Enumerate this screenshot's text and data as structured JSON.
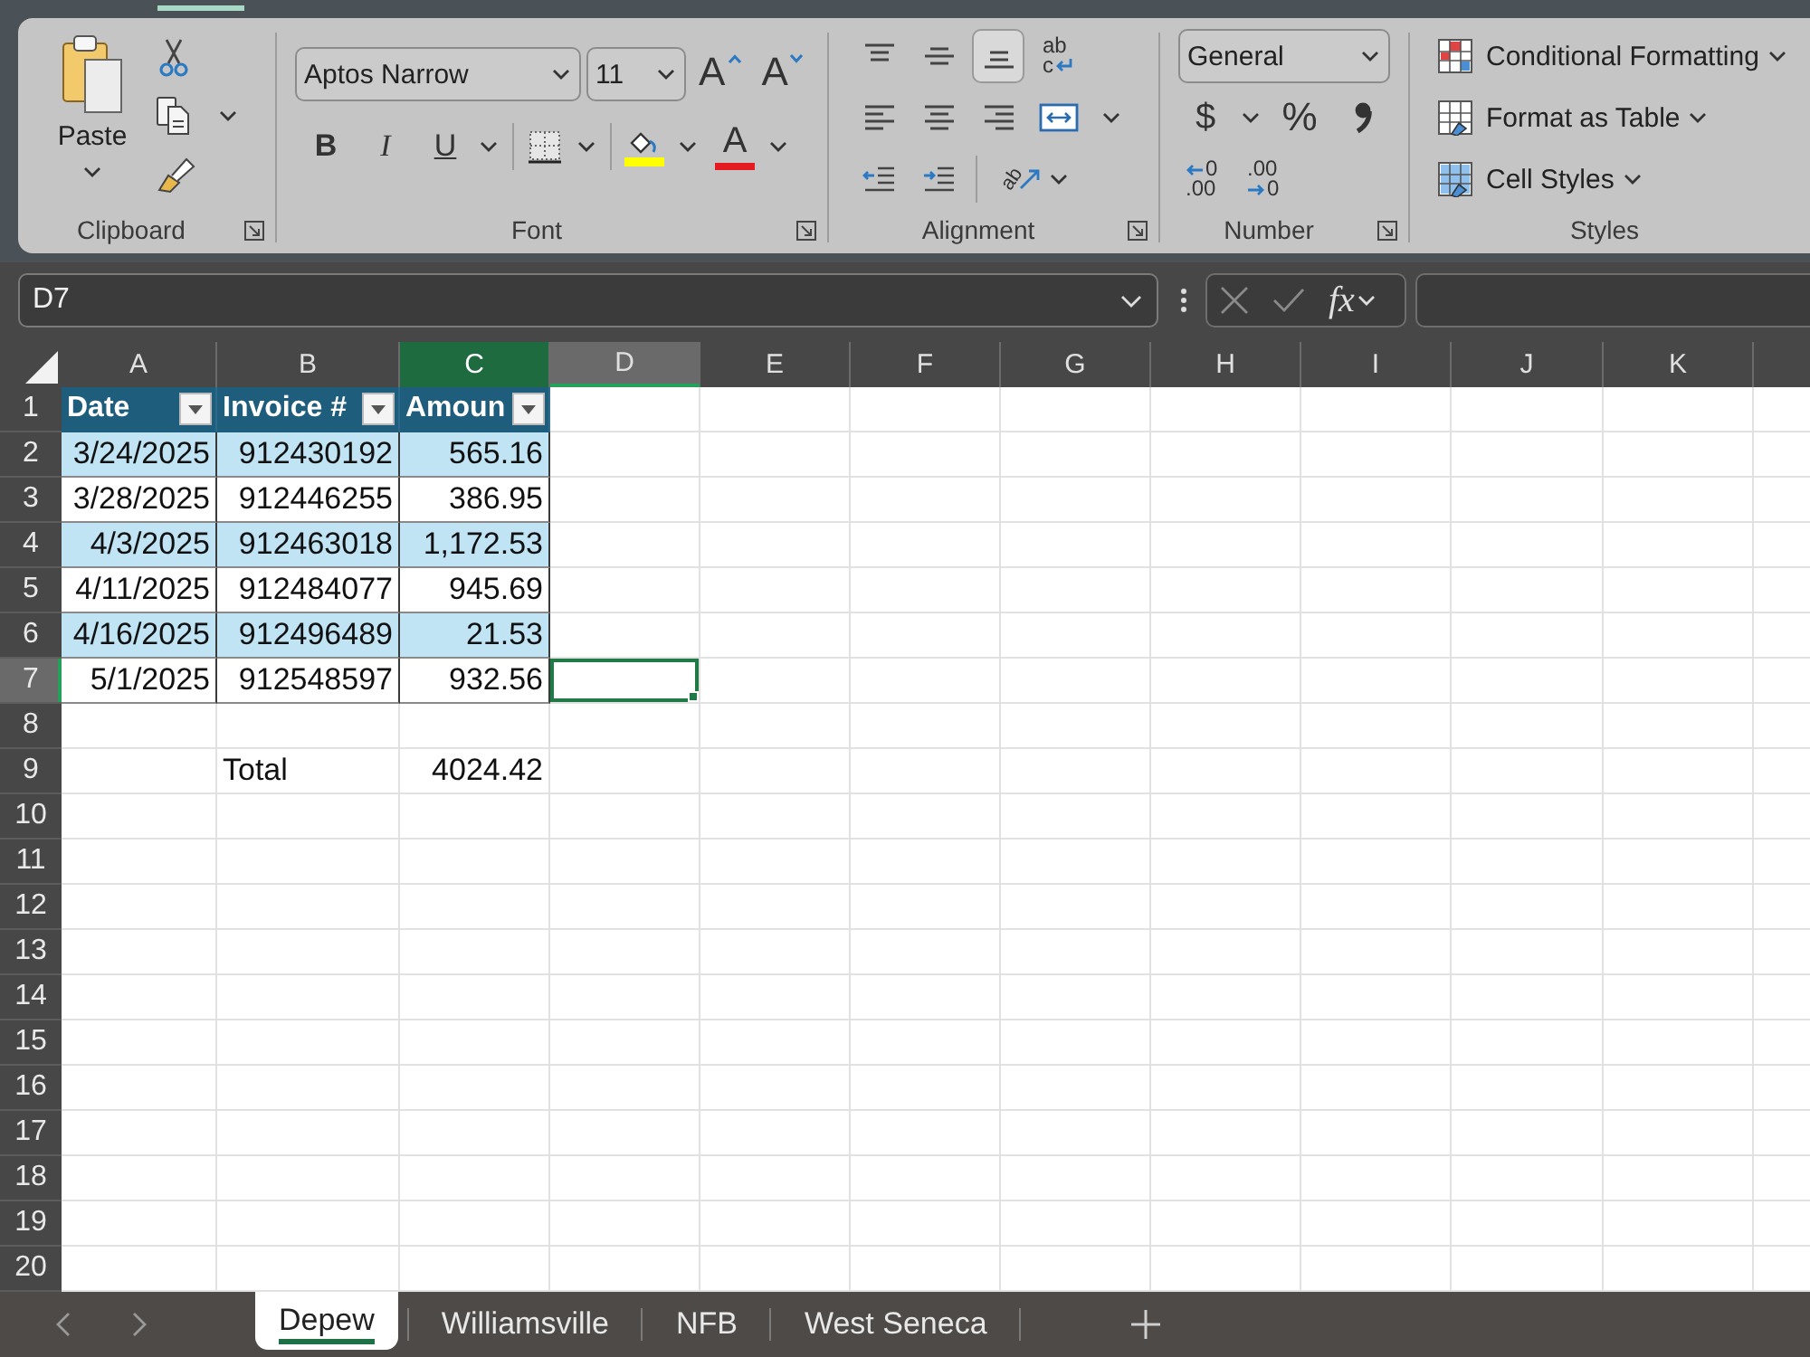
{
  "ribbon": {
    "clipboard": {
      "paste": "Paste",
      "label": "Clipboard"
    },
    "font": {
      "font_name": "Aptos Narrow",
      "font_size": "11",
      "grow": "A",
      "shrink": "A",
      "bold": "B",
      "italic": "I",
      "underline": "U",
      "font_color": "A",
      "label": "Font"
    },
    "alignment": {
      "vertical": [
        {
          "selected": false
        },
        {
          "selected": false
        },
        {
          "selected": true
        }
      ],
      "wrap": [
        "ab",
        "c"
      ],
      "orientation": "ab",
      "label": "Alignment"
    },
    "number": {
      "format": "General",
      "currency": "$",
      "percent": "%",
      "decrease_decimal": [
        "0",
        ".00"
      ],
      "increase_decimal": [
        ".00",
        "0"
      ],
      "label": "Number"
    },
    "styles": {
      "items": [
        "Conditional Formatting",
        "Format as Table",
        "Cell Styles"
      ],
      "label": "Styles"
    }
  },
  "formula_bar": {
    "name_box": "D7",
    "function": "fx"
  },
  "sheet": {
    "columns": [
      {
        "label": "A",
        "selected": false,
        "active": false
      },
      {
        "label": "B",
        "selected": false,
        "active": false
      },
      {
        "label": "C",
        "selected": true,
        "active": false
      },
      {
        "label": "D",
        "selected": false,
        "active": true
      },
      {
        "label": "E",
        "selected": false,
        "active": false
      },
      {
        "label": "F",
        "selected": false,
        "active": false
      },
      {
        "label": "G",
        "selected": false,
        "active": false
      },
      {
        "label": "H",
        "selected": false,
        "active": false
      },
      {
        "label": "I",
        "selected": false,
        "active": false
      },
      {
        "label": "J",
        "selected": false,
        "active": false
      },
      {
        "label": "K",
        "selected": false,
        "active": false
      }
    ],
    "rows": [
      {
        "number": "1",
        "active": false,
        "cells": [
          {
            "text": "Date",
            "kind": "table_header",
            "banded": false,
            "selected": false
          },
          {
            "text": "Invoice #",
            "kind": "table_header",
            "banded": false,
            "selected": false
          },
          {
            "text": "Amoun",
            "kind": "table_header",
            "banded": false,
            "selected": false
          }
        ]
      },
      {
        "number": "2",
        "active": false,
        "cells": [
          {
            "text": "3/24/2025",
            "kind": "table_cell",
            "right_aligned": true,
            "banded": true,
            "selected": false
          },
          {
            "text": "912430192",
            "kind": "table_cell",
            "right_aligned": true,
            "banded": true,
            "selected": false
          },
          {
            "text": "565.16",
            "kind": "table_cell",
            "right_aligned": true,
            "banded": true,
            "selected": false
          }
        ]
      },
      {
        "number": "3",
        "active": false,
        "cells": [
          {
            "text": "3/28/2025",
            "kind": "table_cell",
            "right_aligned": true,
            "banded": false,
            "selected": false
          },
          {
            "text": "912446255",
            "kind": "table_cell",
            "right_aligned": true,
            "banded": false,
            "selected": false
          },
          {
            "text": "386.95",
            "kind": "table_cell",
            "right_aligned": true,
            "banded": false,
            "selected": false
          }
        ]
      },
      {
        "number": "4",
        "active": false,
        "cells": [
          {
            "text": "4/3/2025",
            "kind": "table_cell",
            "right_aligned": true,
            "banded": true,
            "selected": false
          },
          {
            "text": "912463018",
            "kind": "table_cell",
            "right_aligned": true,
            "banded": true,
            "selected": false
          },
          {
            "text": "1,172.53",
            "kind": "table_cell",
            "right_aligned": true,
            "banded": true,
            "selected": false
          }
        ]
      },
      {
        "number": "5",
        "active": false,
        "cells": [
          {
            "text": "4/11/2025",
            "kind": "table_cell",
            "right_aligned": true,
            "banded": false,
            "selected": false
          },
          {
            "text": "912484077",
            "kind": "table_cell",
            "right_aligned": true,
            "banded": false,
            "selected": false
          },
          {
            "text": "945.69",
            "kind": "table_cell",
            "right_aligned": true,
            "banded": false,
            "selected": false
          }
        ]
      },
      {
        "number": "6",
        "active": false,
        "cells": [
          {
            "text": "4/16/2025",
            "kind": "table_cell",
            "right_aligned": true,
            "banded": true,
            "selected": false
          },
          {
            "text": "912496489",
            "kind": "table_cell",
            "right_aligned": true,
            "banded": true,
            "selected": false
          },
          {
            "text": "21.53",
            "kind": "table_cell",
            "right_aligned": true,
            "banded": true,
            "selected": false
          }
        ]
      },
      {
        "number": "7",
        "active": true,
        "cells": [
          {
            "text": "5/1/2025",
            "kind": "table_cell",
            "right_aligned": true,
            "banded": false,
            "selected": false
          },
          {
            "text": "912548597",
            "kind": "table_cell",
            "right_aligned": true,
            "banded": false,
            "selected": false
          },
          {
            "text": "932.56",
            "kind": "table_cell",
            "right_aligned": true,
            "banded": false,
            "selected": false
          },
          {
            "kind": "plain",
            "banded": false,
            "selected": true
          }
        ]
      },
      {
        "number": "8",
        "active": false
      },
      {
        "number": "9",
        "active": false,
        "cells": [
          null,
          {
            "text": "Total",
            "kind": "plain",
            "right_aligned": false,
            "banded": false,
            "selected": false
          },
          {
            "text": "4024.42",
            "kind": "plain",
            "right_aligned": true,
            "banded": false,
            "selected": false
          }
        ]
      },
      {
        "number": "10",
        "active": false
      },
      {
        "number": "11",
        "active": false
      },
      {
        "number": "12",
        "active": false
      },
      {
        "number": "13",
        "active": false
      },
      {
        "number": "14",
        "active": false
      },
      {
        "number": "15",
        "active": false
      },
      {
        "number": "16",
        "active": false
      },
      {
        "number": "17",
        "active": false
      },
      {
        "number": "18",
        "active": false
      },
      {
        "number": "19",
        "active": false
      },
      {
        "number": "20",
        "active": false
      }
    ]
  },
  "sheet_tabs": [
    {
      "label": "Depew",
      "selected": true
    },
    {
      "label": "Williamsville",
      "selected": false
    },
    {
      "label": "NFB",
      "selected": false
    },
    {
      "label": "West Seneca",
      "selected": false
    }
  ]
}
